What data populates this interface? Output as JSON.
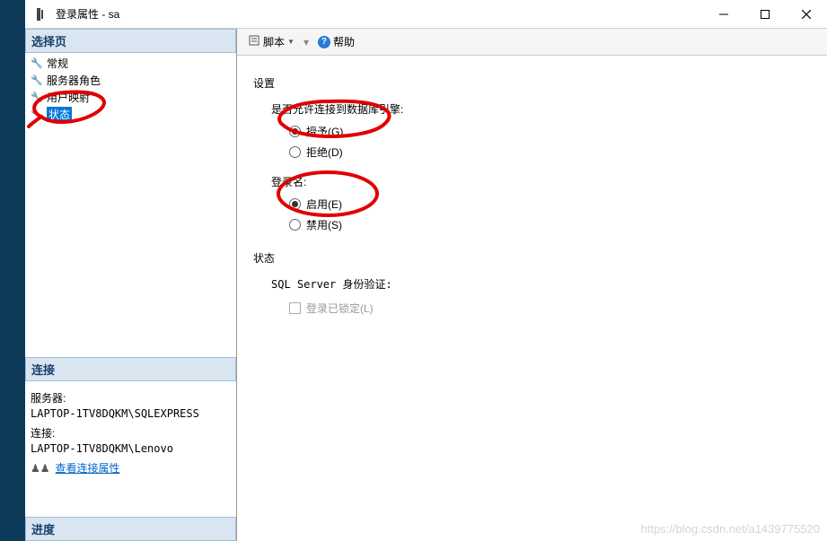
{
  "window": {
    "title": "登录属性 - sa"
  },
  "leftcol": {
    "selectPage": {
      "header": "选择页",
      "items": [
        {
          "label": "常规"
        },
        {
          "label": "服务器角色"
        },
        {
          "label": "用户映射"
        },
        {
          "label": "状态"
        }
      ],
      "selectedIndex": 3
    },
    "connection": {
      "header": "连接",
      "serverLabel": "服务器:",
      "serverValue": "LAPTOP-1TV8DQKM\\SQLEXPRESS",
      "connLabel": "连接:",
      "connValue": "LAPTOP-1TV8DQKM\\Lenovo",
      "viewPropsLink": "查看连接属性"
    },
    "progress": {
      "header": "进度"
    }
  },
  "toolbar": {
    "scriptLabel": "脚本",
    "helpLabel": "帮助"
  },
  "main": {
    "settings": {
      "title": "设置",
      "permission": {
        "label": "是否允许连接到数据库引擎:",
        "grant": "授予(G)",
        "deny": "拒绝(D)"
      },
      "login": {
        "label": "登录名:",
        "enable": "启用(E)",
        "disable": "禁用(S)"
      }
    },
    "status": {
      "title": "状态",
      "sqlAuth": "SQL Server 身份验证:",
      "lockedLabel": "登录已锁定(L)"
    }
  },
  "watermark": "https://blog.csdn.net/a1439775520"
}
